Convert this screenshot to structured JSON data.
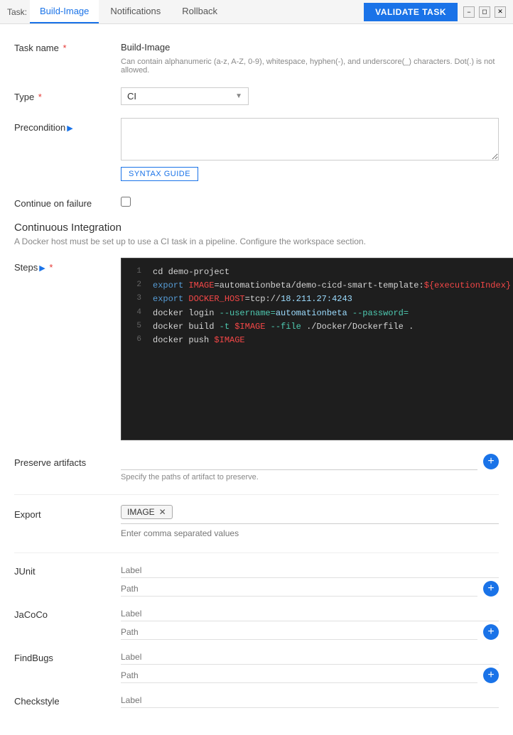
{
  "tabs": [
    {
      "id": "build-image",
      "label": "Build-Image",
      "active": true
    },
    {
      "id": "notifications",
      "label": "Notifications",
      "active": false
    },
    {
      "id": "rollback",
      "label": "Rollback",
      "active": false
    }
  ],
  "tab_prefix": "Task:",
  "validate_btn": "VALIDATE TASK",
  "form": {
    "task_name_label": "Task name",
    "task_name_value": "Build-Image",
    "task_name_hint": "Can contain alphanumeric (a-z, A-Z, 0-9), whitespace, hyphen(-), and underscore(_) characters. Dot(.) is not allowed.",
    "type_label": "Type",
    "type_value": "CI",
    "precondition_label": "Precondition",
    "precondition_value": "",
    "precondition_placeholder": "",
    "syntax_guide_btn": "SYNTAX GUIDE",
    "continue_failure_label": "Continue on failure",
    "section_title": "Continuous Integration",
    "section_desc": "A Docker host must be set up to use a CI task in a pipeline. Configure the workspace section.",
    "steps_label": "Steps",
    "code_lines": [
      {
        "num": "1",
        "content": "cd demo-project",
        "type": "plain"
      },
      {
        "num": "2",
        "content": "export IMAGE=automationbeta/demo-cicd-smart-template:${executionIndex}",
        "type": "export_image"
      },
      {
        "num": "3",
        "content": "export DOCKER_HOST=tcp://18.211.27:4243",
        "type": "export_docker"
      },
      {
        "num": "4",
        "content": "docker login --username=automationbeta --password=",
        "type": "docker_login"
      },
      {
        "num": "5",
        "content": "docker build -t $IMAGE --file ./Docker/Dockerfile .",
        "type": "docker_build"
      },
      {
        "num": "6",
        "content": "docker push $IMAGE",
        "type": "docker_push"
      }
    ],
    "preserve_artifacts_label": "Preserve artifacts",
    "preserve_hint": "Specify the paths of artifact to preserve.",
    "export_label": "Export",
    "export_tags": [
      {
        "value": "IMAGE",
        "removable": true
      }
    ],
    "export_input_placeholder": "Enter comma separated values",
    "junit_label": "JUnit",
    "junit_label_placeholder": "Label",
    "junit_path_placeholder": "Path",
    "jacoco_label": "JaCoCo",
    "jacoco_label_placeholder": "Label",
    "jacoco_path_placeholder": "Path",
    "findbugs_label": "FindBugs",
    "findbugs_label_placeholder": "Label",
    "findbugs_path_placeholder": "Path",
    "checkstyle_label": "Checkstyle",
    "checkstyle_label_placeholder": "Label"
  },
  "colors": {
    "accent": "#1a73e8",
    "required": "#e53935",
    "code_bg": "#1e1e1e",
    "code_image": "#f44747",
    "code_host": "#9cdcfe",
    "code_keyword": "#569cd6",
    "code_plain": "#d4d4d4",
    "code_green": "#4ec9b0"
  }
}
